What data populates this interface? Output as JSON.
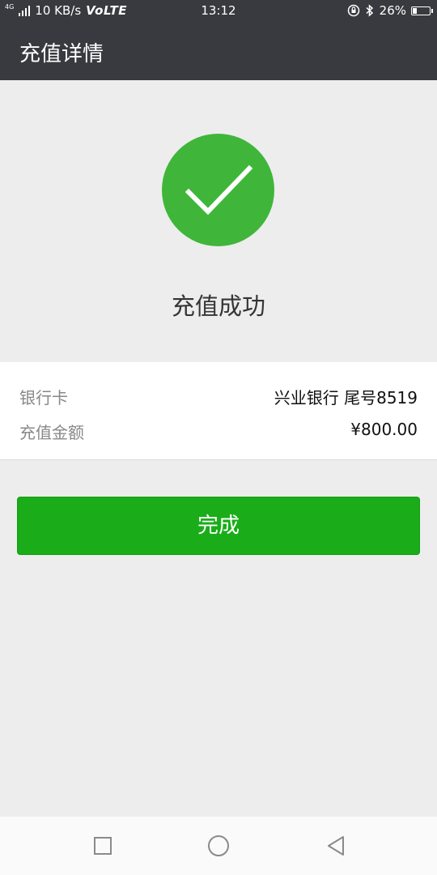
{
  "status_bar": {
    "network_type": "4G",
    "speed": "10 KB/s",
    "volte": "VoLTE",
    "time": "13:12",
    "battery": "26%",
    "battery_level": 0.26
  },
  "app_bar": {
    "title": "充值详情"
  },
  "result": {
    "message": "充值成功",
    "icon": "checkmark-icon",
    "icon_color": "#3fb63a"
  },
  "details": [
    {
      "label": "银行卡",
      "value": "兴业银行 尾号8519"
    },
    {
      "label": "充值金额",
      "value": "¥800.00"
    }
  ],
  "done_button": {
    "label": "完成",
    "color": "#1aad19"
  },
  "nav_bar": {
    "recent": "square-icon",
    "home": "circle-icon",
    "back": "triangle-back-icon"
  }
}
